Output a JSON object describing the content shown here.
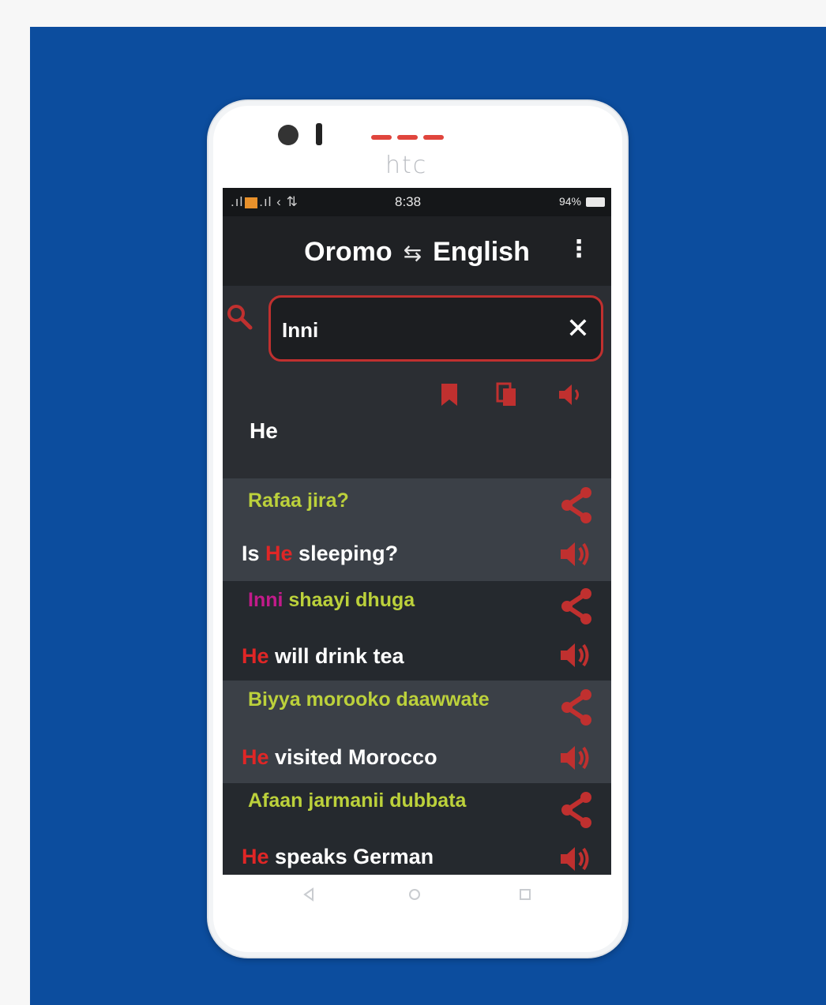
{
  "device": {
    "brand": "htc"
  },
  "status_bar": {
    "time": "8:38",
    "battery": "94%"
  },
  "app_bar": {
    "source_language": "Oromo",
    "target_language": "English",
    "swap_icon": "swap-arrows-icon",
    "menu_icon": "more-vert-icon"
  },
  "search": {
    "value": "Inni",
    "clear_icon": "close-icon"
  },
  "entry": {
    "headword": "He",
    "actions": [
      "bookmark-icon",
      "copy-icon",
      "speaker-icon"
    ]
  },
  "phrases": [
    {
      "oromo": [
        "Rafaa jira?"
      ],
      "english_pre": "Is ",
      "english_hl": "He",
      "english_post": " sleeping?",
      "bg": "light"
    },
    {
      "oromo_hl": "Inni",
      "oromo_post": " shaayi dhuga",
      "english_hl": "He",
      "english_post": " will drink tea",
      "bg": "dark"
    },
    {
      "oromo": [
        "Biyya morooko daawwate"
      ],
      "english_hl": "He",
      "english_post": " visited Morocco",
      "bg": "light"
    },
    {
      "oromo": [
        "Afaan jarmanii dubbata"
      ],
      "english_hl": "He",
      "english_post": " speaks German",
      "bg": "dark"
    }
  ],
  "colors": {
    "accent": "#c0302f",
    "oromo_text": "#bcd13b",
    "highlight": "#e02626",
    "highlight_alt": "#c21b8a",
    "background": "#0c4d9e"
  }
}
